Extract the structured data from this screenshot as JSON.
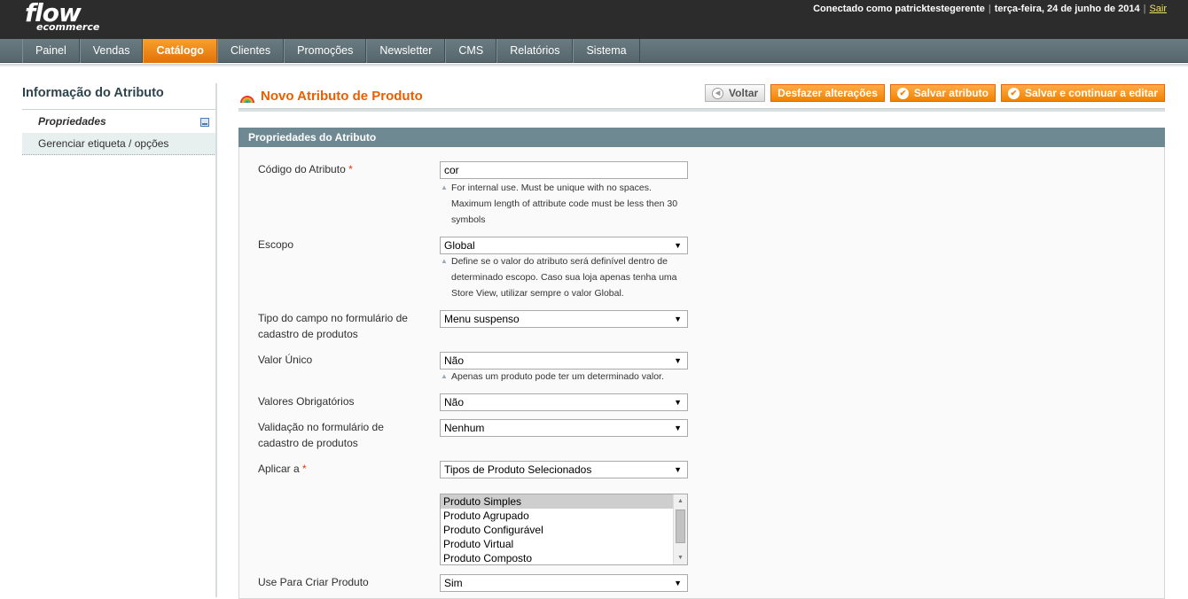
{
  "brand": {
    "flow": "flow",
    "ecommerce": "ecommerce"
  },
  "header": {
    "logged_in": "Conectado como patricktestegerente",
    "date": "terça-feira, 24 de junho de 2014",
    "logout": "Sair"
  },
  "nav": [
    {
      "label": "Painel"
    },
    {
      "label": "Vendas"
    },
    {
      "label": "Catálogo",
      "active": true
    },
    {
      "label": "Clientes"
    },
    {
      "label": "Promoções"
    },
    {
      "label": "Newsletter"
    },
    {
      "label": "CMS"
    },
    {
      "label": "Relatórios"
    },
    {
      "label": "Sistema"
    }
  ],
  "sidebar": {
    "title": "Informação do Atributo",
    "tabs": [
      {
        "label": "Propriedades",
        "active": true
      },
      {
        "label": "Gerenciar etiqueta / opções"
      }
    ]
  },
  "page": {
    "title": "Novo Atributo de Produto",
    "buttons": {
      "back": "Voltar",
      "reset": "Desfazer alterações",
      "save": "Salvar atributo",
      "save_continue": "Salvar e continuar a editar"
    }
  },
  "section": {
    "title": "Propriedades do Atributo",
    "attribute_code": {
      "label": "Código do Atributo",
      "required": "*",
      "value": "cor",
      "note": [
        "For internal use. Must be unique with no spaces.",
        "Maximum length of attribute code must be less then 30",
        "symbols"
      ]
    },
    "scope": {
      "label": "Escopo",
      "value": "Global",
      "note": [
        "Define se o valor do atributo será definível dentro de",
        "determinado escopo. Caso sua loja apenas tenha uma",
        "Store View, utilizar sempre o valor Global."
      ]
    },
    "input_type": {
      "label_line1": "Tipo do campo no formulário de",
      "label_line2": "cadastro de produtos",
      "value": "Menu suspenso"
    },
    "unique": {
      "label": "Valor Único",
      "value": "Não",
      "note": "Apenas um produto pode ter um determinado valor."
    },
    "required_values": {
      "label": "Valores Obrigatórios",
      "value": "Não"
    },
    "validation": {
      "label_line1": "Validação no formulário de",
      "label_line2": "cadastro de produtos",
      "value": "Nenhum"
    },
    "apply_to": {
      "label": "Aplicar a",
      "required": "*",
      "value": "Tipos de Produto Selecionados",
      "options": [
        "Produto Simples",
        "Produto Agrupado",
        "Produto Configurável",
        "Produto Virtual",
        "Produto Composto"
      ]
    },
    "use_to_create": {
      "label": "Use Para Criar Produto",
      "value": "Sim"
    }
  },
  "colors": {
    "accent": "#eb5e00",
    "nav": "#5f7076",
    "section_head": "#6f8992",
    "button": "#f18200"
  }
}
